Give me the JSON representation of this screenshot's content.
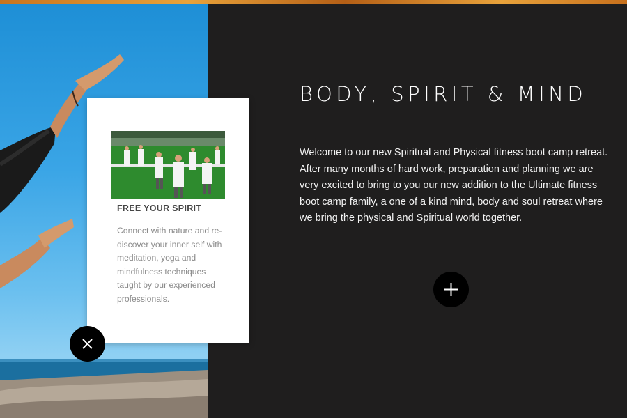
{
  "section": {
    "title": "BODY, SPIRIT & MIND",
    "intro": "Welcome to our new Spiritual and Physical fitness boot camp retreat. After many months of hard work, preparation and planning we are very excited to bring to you our new addition to the Ultimate fitness boot camp family, a one of a kind mind, body and soul retreat where we bring the physical and Spiritual world together."
  },
  "card": {
    "title": "FREE YOUR SPIRIT",
    "text": "Connect with nature and re-discover your inner self with meditation, yoga and mindfulness techniques taught by our experienced professionals."
  },
  "icons": {
    "close": "close-icon",
    "expand": "plus-icon"
  },
  "colors": {
    "panel_background": "#1f1e1e",
    "card_background": "#ffffff",
    "button_background": "#000000",
    "top_strip": "#d98a2b",
    "sky": "#2a9de0"
  }
}
